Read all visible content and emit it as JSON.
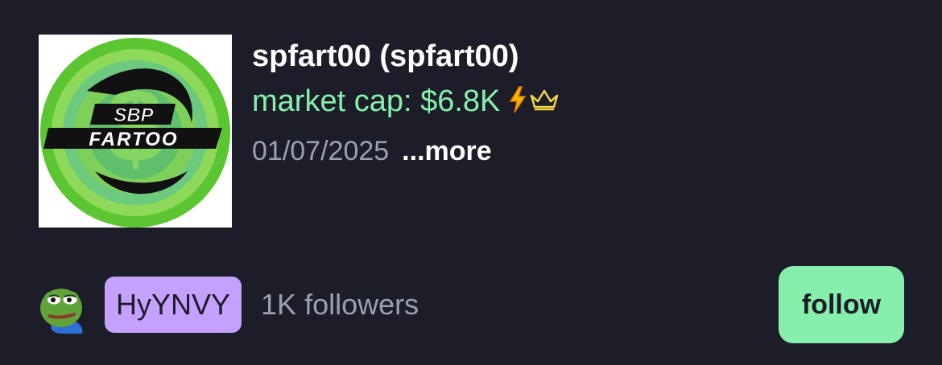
{
  "token": {
    "title": "spfart00 (spfart00)",
    "market_cap": "market cap: $6.8K",
    "date": "01/07/2025",
    "more_label": "...more",
    "logo_text_top": "SBP",
    "logo_text_bottom": "FARTOO",
    "icons": [
      "bolt-icon",
      "crown-icon"
    ]
  },
  "creator": {
    "avatar_icon": "pepe-frog-avatar",
    "handle": "HyYNVY",
    "followers": "1K followers"
  },
  "actions": {
    "follow_label": "follow"
  },
  "colors": {
    "background": "#1c1d29",
    "accent_green": "#86efac",
    "badge_purple": "#c4a1ff",
    "muted_text": "#9aa0ad"
  }
}
